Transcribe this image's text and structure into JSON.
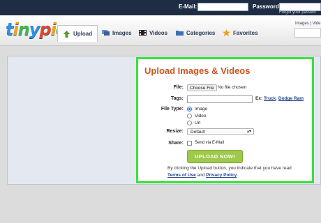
{
  "colors": {
    "accent_green": "#39e23a",
    "title_orange": "#c9541c",
    "topbar": "#1f2d44",
    "button_green": "#9ec94a"
  },
  "topbar": {
    "email_label": "E-Mail:",
    "password_label": "Password:",
    "forgot_text": "Forgot your passwo"
  },
  "logo": {
    "text": "tinypic"
  },
  "nav": {
    "items": [
      {
        "label": "Upload",
        "icon": "up-arrow-icon"
      },
      {
        "label": "Images",
        "icon": "images-icon"
      },
      {
        "label": "Videos",
        "icon": "film-icon"
      },
      {
        "label": "Categories",
        "icon": "folder-icon"
      },
      {
        "label": "Favorites",
        "icon": "star-icon"
      }
    ],
    "right_text": "Images | Vide"
  },
  "upload": {
    "title": "Upload Images & Videos",
    "file_label": "File:",
    "choose_button": "Choose File",
    "no_file_text": "No file chosen",
    "tags_label": "Tags:",
    "tags_value": "",
    "ex_prefix": "Ex:",
    "ex_link1": "Truck",
    "ex_sep": ",",
    "ex_link2": "Dodge Ram",
    "file_type_label": "File Type:",
    "file_types": [
      "Image",
      "Video",
      "Url"
    ],
    "resize_label": "Resize:",
    "resize_value": "Default",
    "share_label": "Share:",
    "share_option": "Send via E-Mail",
    "upload_button": "UPLOAD NOW!",
    "disclaimer_text": "By clicking the Upload button, you indicate that you have read",
    "terms_link": "Terms of Use",
    "and_text": "and",
    "privacy_link": "Privacy Policy",
    "period": "."
  }
}
